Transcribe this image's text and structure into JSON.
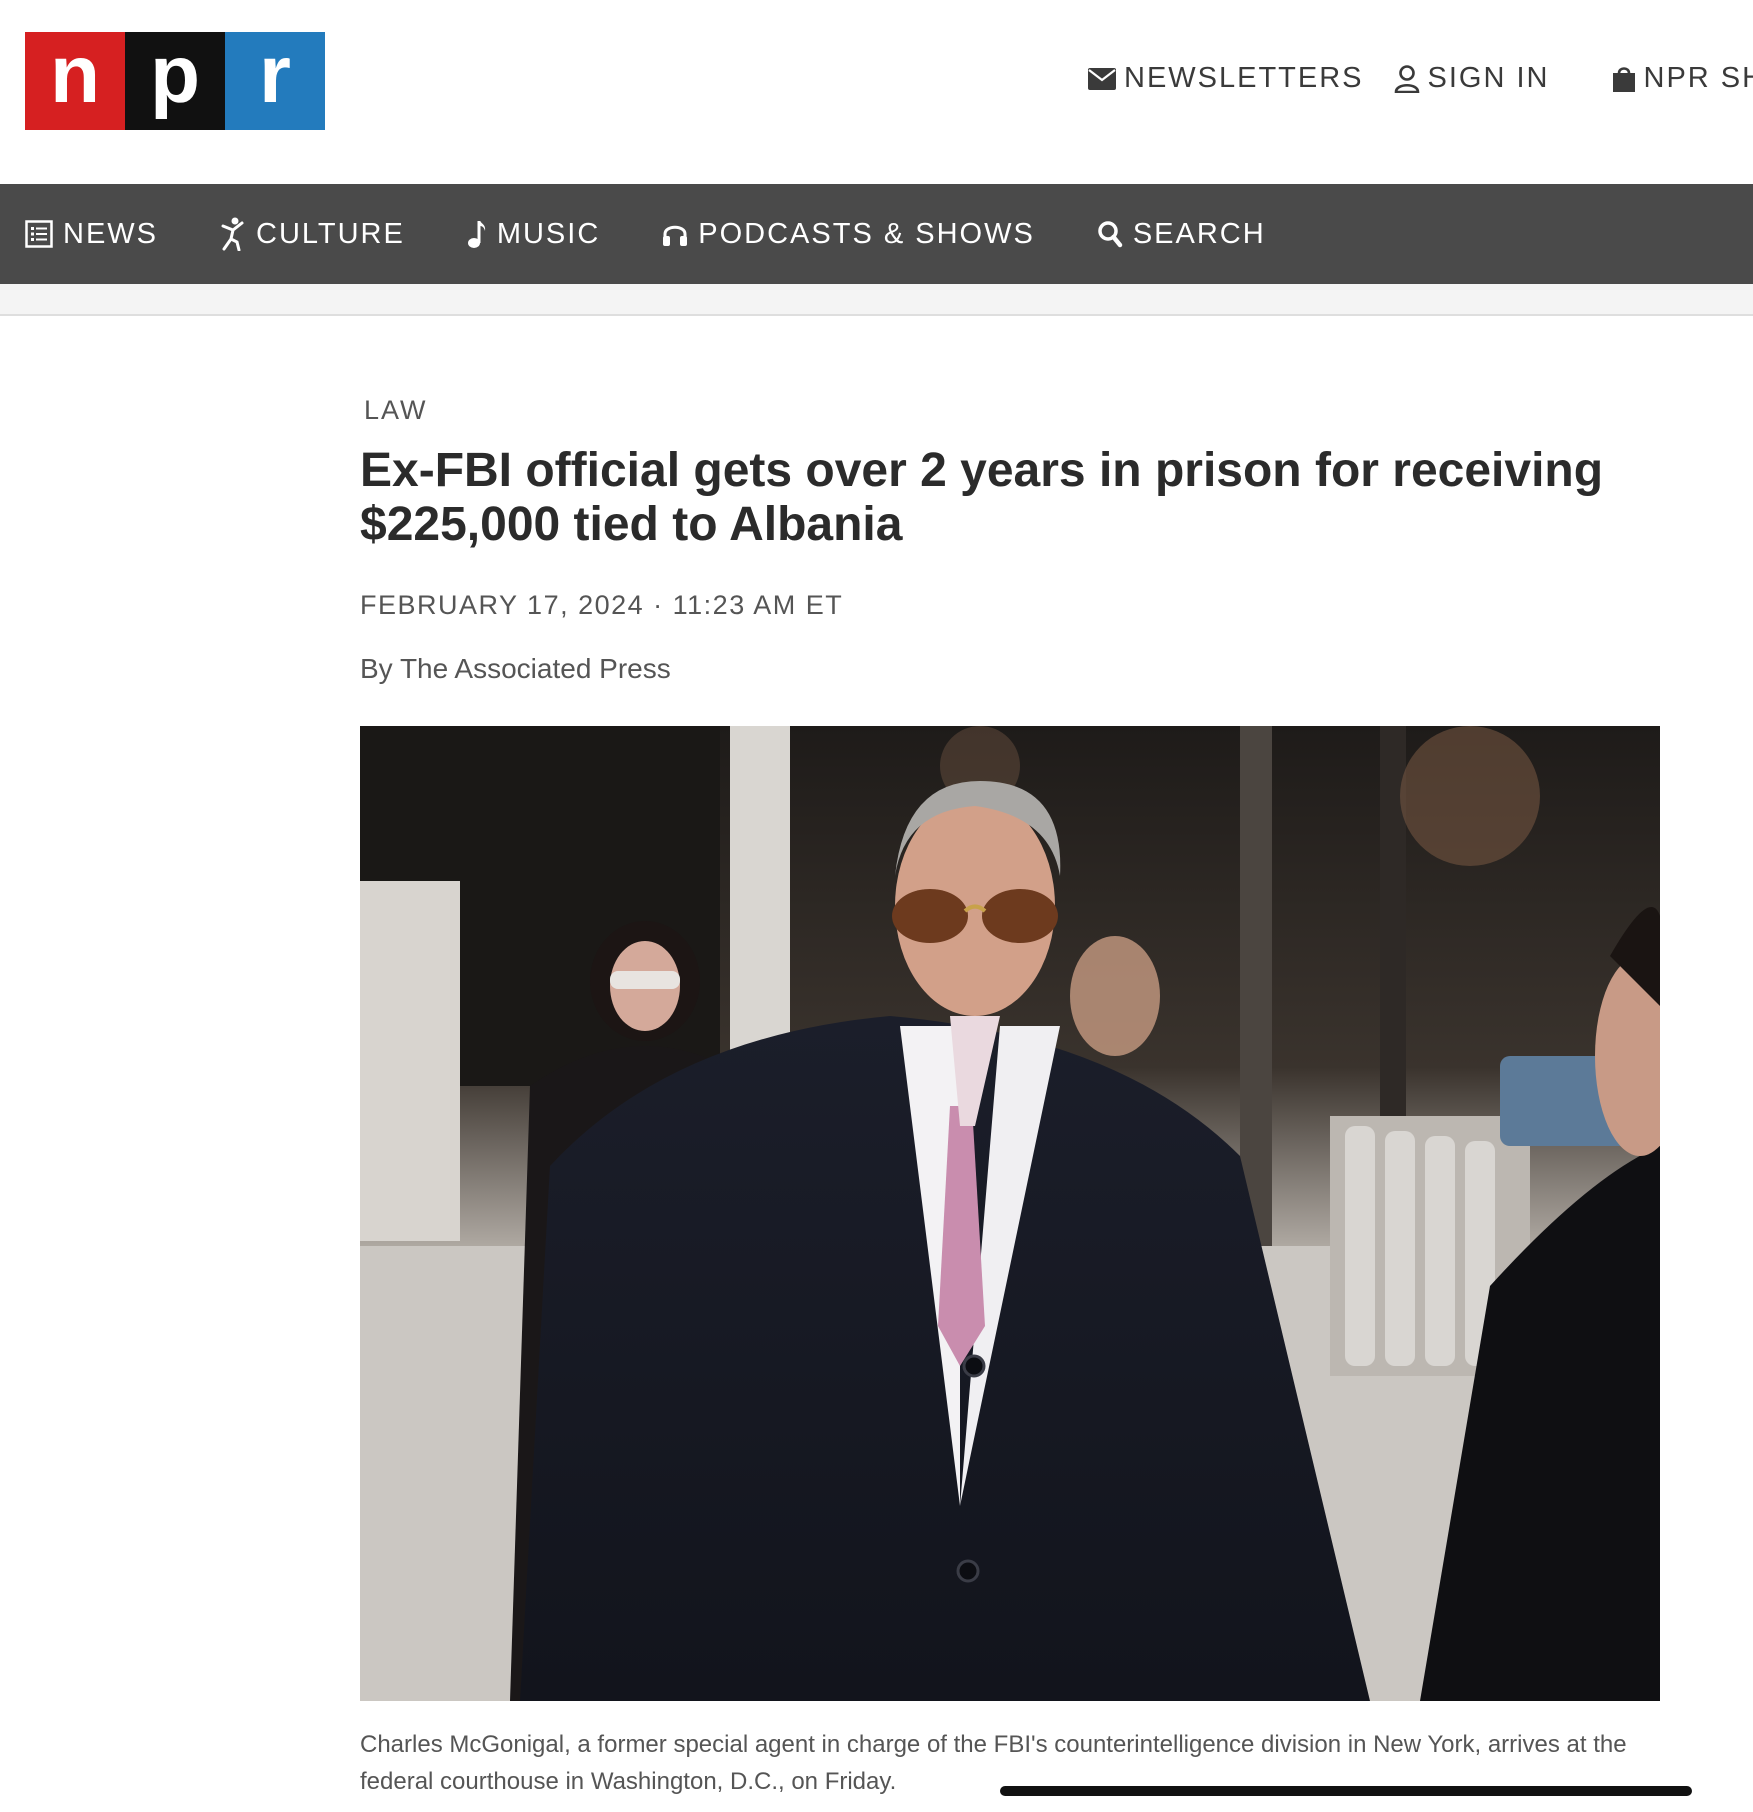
{
  "brand": {
    "letters": [
      "n",
      "p",
      "r"
    ],
    "colors": {
      "n": "#d62021",
      "p": "#111111",
      "r": "#237bbd"
    }
  },
  "utility_nav": {
    "newsletters": "NEWSLETTERS",
    "sign_in": "SIGN IN",
    "shop": "NPR SHOP"
  },
  "main_nav": {
    "items": [
      {
        "label": "NEWS",
        "icon": "news-icon"
      },
      {
        "label": "CULTURE",
        "icon": "culture-icon"
      },
      {
        "label": "MUSIC",
        "icon": "music-note-icon"
      },
      {
        "label": "PODCASTS & SHOWS",
        "icon": "headphones-icon"
      },
      {
        "label": "SEARCH",
        "icon": "search-icon"
      }
    ],
    "bg_color": "#4a4a4a"
  },
  "article": {
    "section": "LAW",
    "headline": "Ex-FBI official gets over 2 years in prison for receiving $225,000 tied to Albania",
    "dateline": "FEBRUARY 17, 2024 · 11:23 AM ET",
    "byline": "By The Associated Press",
    "photo_caption": "Charles McGonigal, a former special agent in charge of the FBI's counterintelligence division in New York, arrives at the federal courthouse in Washington, D.C., on Friday."
  }
}
